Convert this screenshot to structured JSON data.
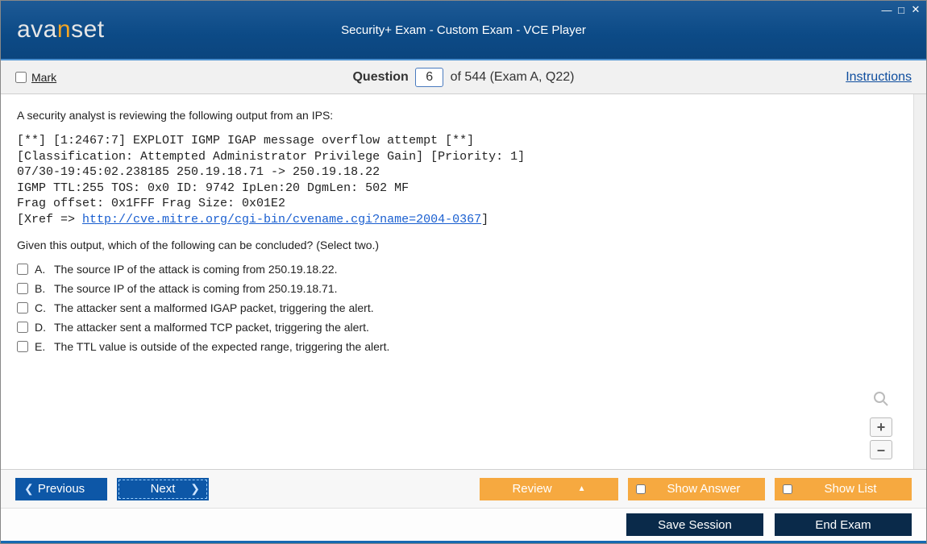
{
  "window": {
    "title": "Security+ Exam - Custom Exam - VCE Player",
    "logo_prefix": "ava",
    "logo_accent": "n",
    "logo_suffix": "set"
  },
  "header": {
    "mark_label": "Mark",
    "question_label": "Question",
    "question_number": "6",
    "question_total": "of 544 (Exam A, Q22)",
    "instructions_label": "Instructions"
  },
  "question": {
    "prompt": "A security analyst is reviewing the following output from an IPS:",
    "ips_lines": [
      "[**] [1:2467:7] EXPLOIT IGMP IGAP message overflow attempt [**]",
      "[Classification: Attempted Administrator Privilege Gain] [Priority: 1]",
      "07/30-19:45:02.238185 250.19.18.71 -> 250.19.18.22",
      "IGMP TTL:255 TOS: 0x0 ID: 9742 IpLen:20 DgmLen: 502 MF",
      "Frag offset: 0x1FFF Frag Size: 0x01E2"
    ],
    "ips_xref_prefix": "[Xref => ",
    "ips_xref_link": "http://cve.mitre.org/cgi-bin/cvename.cgi?name=2004-0367",
    "ips_xref_suffix": "]",
    "followup": "Given this output, which of the following can be concluded? (Select two.)",
    "options": [
      {
        "letter": "A.",
        "text": "The source IP of the attack is coming from 250.19.18.22."
      },
      {
        "letter": "B.",
        "text": "The source IP of the attack is coming from 250.19.18.71."
      },
      {
        "letter": "C.",
        "text": "The attacker sent a malformed IGAP packet, triggering the alert."
      },
      {
        "letter": "D.",
        "text": "The attacker sent a malformed TCP packet, triggering the alert."
      },
      {
        "letter": "E.",
        "text": "The TTL value is outside of the expected range, triggering the alert."
      }
    ]
  },
  "actions": {
    "previous": "Previous",
    "next": "Next",
    "review": "Review",
    "show_answer": "Show Answer",
    "show_list": "Show List",
    "save_session": "Save Session",
    "end_exam": "End Exam"
  }
}
